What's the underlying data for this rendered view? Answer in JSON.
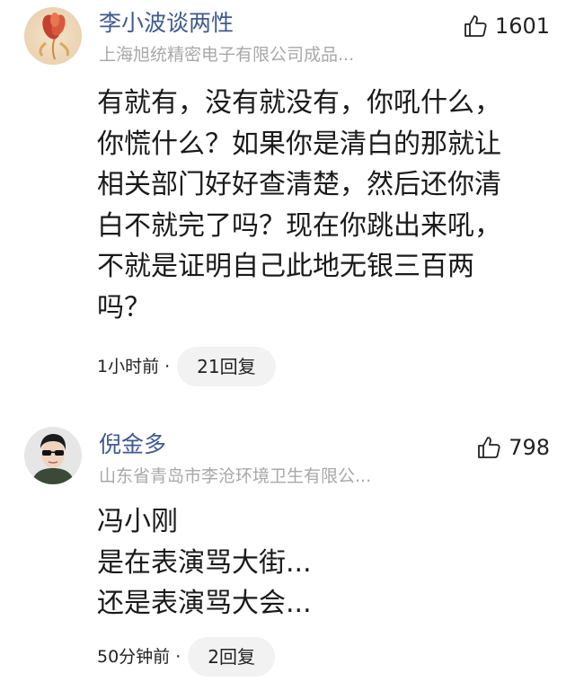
{
  "comments": [
    {
      "author": "李小波谈两性",
      "org": "上海旭统精密电子有限公司成品...",
      "likes": "1601",
      "avatar_icon": "flower-avatar",
      "body_lines": [
        "有就有，没有就没有，你吼什么，",
        "你慌什么？如果你是清白的那就让",
        "相关部门好好查清楚，然后还你清",
        "白不就完了吗？现在你跳出来吼，",
        "不就是证明自己此地无银三百两",
        "吗？"
      ],
      "time": "1小时前",
      "separator": "·",
      "replies": "21回复"
    },
    {
      "author": "倪金多",
      "org": "山东省青岛市李沧环境卫生有限公...",
      "likes": "798",
      "avatar_icon": "person-sunglasses-avatar",
      "body_lines": [
        "冯小刚",
        "是在表演骂大街...",
        "还是表演骂大会..."
      ],
      "time": "50分钟前",
      "separator": "·",
      "replies": "2回复"
    }
  ],
  "colors": {
    "author": "#3f5a8f",
    "org": "#a8a8a8",
    "text": "#1a1a1a",
    "pill_bg": "#f2f2f2"
  },
  "icons": {
    "like": "thumbs-up-icon"
  }
}
